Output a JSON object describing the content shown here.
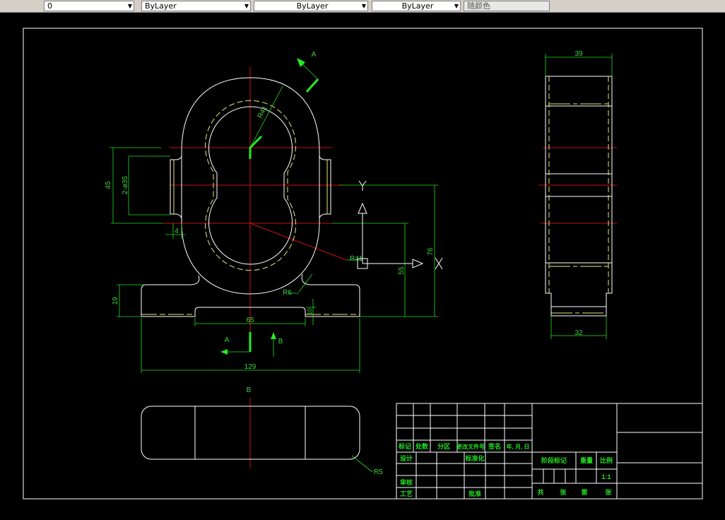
{
  "toolbar": {
    "layer_value": "0",
    "color_value": "ByLayer",
    "linetype_value": "ByLayer",
    "lineweight_value": "ByLayer",
    "plotstyle_value": "随颜色"
  },
  "drawing": {
    "main_view": {
      "section_label_top": "A",
      "radius_outer": "R41",
      "dim_45": "45",
      "dim_holes": "2-ø35",
      "dim_4": "4",
      "dim_19": "19",
      "dim_65": "65",
      "dim_10": "10",
      "dim_129": "129",
      "radius_fillet": "R6",
      "radius_41_leader": "R41",
      "dim_55": "55",
      "dim_76": "76",
      "section_label_bottom": "A",
      "view_arrow_label": "B",
      "ucs_x": "X",
      "ucs_y": "Y"
    },
    "side_view": {
      "dim_width": "39",
      "dim_base": "32"
    },
    "bottom_view": {
      "label": "B",
      "radius": "R5"
    }
  },
  "title_block": {
    "header": [
      "标记",
      "处数",
      "分区",
      "更改文件号",
      "签名",
      "年, 月, 日"
    ],
    "design": "设计",
    "standardization": "标准化",
    "review": "审核",
    "process": "工艺",
    "approve": "批准",
    "stage_mark": "阶段标记",
    "weight": "重量",
    "scale": "比例",
    "scale_value": "1:1",
    "total": "共",
    "sheets1": "张",
    "nth": "第",
    "sheets2": "张"
  }
}
